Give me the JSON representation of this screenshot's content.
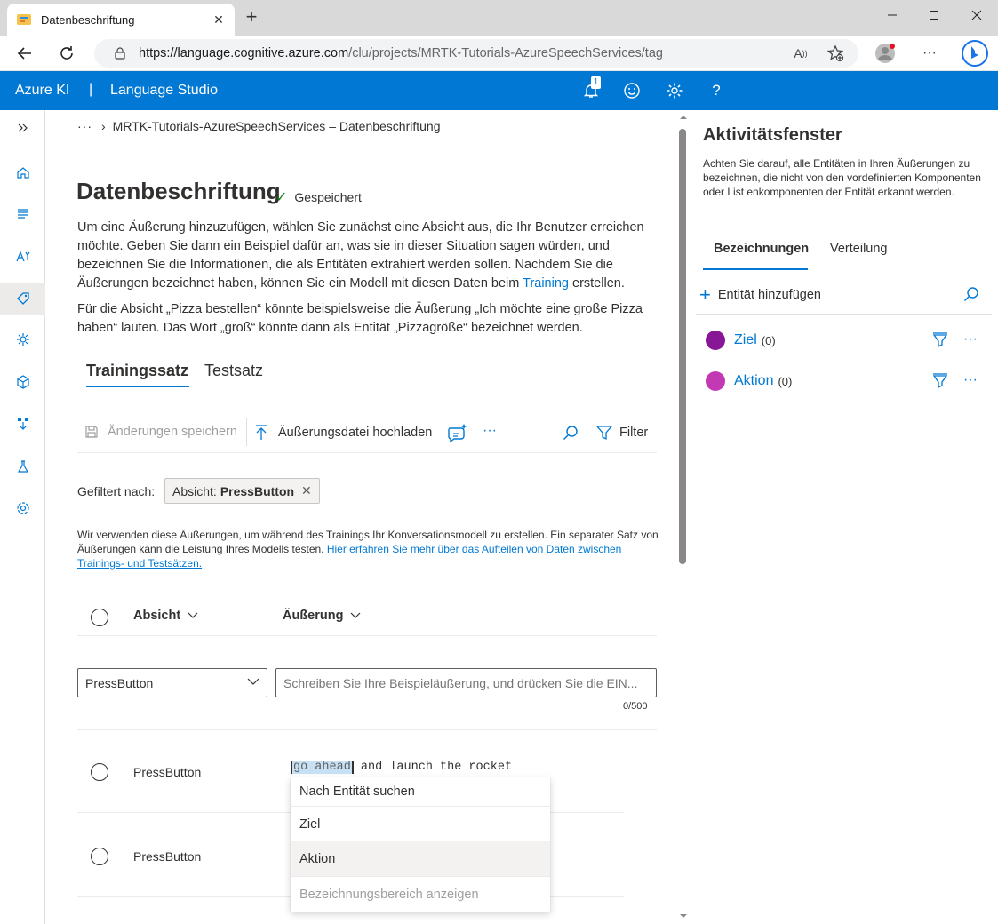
{
  "browser": {
    "tab_title": "Datenbeschriftung",
    "url_host": "https://language.cognitive.azure.com",
    "url_path": "/clu/projects/MRTK-Tutorials-AzureSpeechServices/tag"
  },
  "header": {
    "brand": "Azure KI",
    "separator": "|",
    "studio": "Language Studio",
    "notification_count": "1",
    "help": "?"
  },
  "breadcrumb": {
    "dots": "···",
    "chevron": "›",
    "text": "MRTK-Tutorials-AzureSpeechServices – Datenbeschriftung"
  },
  "page": {
    "title": "Datenbeschriftung",
    "saved_label": "Gespeichert",
    "intro_part1": "Um eine Äußerung hinzuzufügen, wählen Sie zunächst eine Absicht aus, die Ihr Benutzer erreichen möchte. Geben Sie dann ein Beispiel dafür an, was sie in dieser Situation sagen würden, und bezeichnen Sie die Informationen, die als Entitäten extrahiert werden sollen. Nachdem Sie die Äußerungen bezeichnet haben, können Sie ein Modell mit diesen Daten beim ",
    "intro_link": "Training",
    "intro_part2": " erstellen.",
    "example": "Für die Absicht „Pizza bestellen“ könnte beispielsweise die Äußerung „Ich möchte eine große Pizza haben“ lauten. Das Wort „groß“ könnte dann als Entität „Pizzagröße“ bezeichnet werden."
  },
  "pivots": {
    "training": "Trainingssatz",
    "test": "Testsatz"
  },
  "toolbar": {
    "save": "Änderungen speichern",
    "upload": "Äußerungsdatei hochladen",
    "more": "···",
    "filter": "Filter"
  },
  "filter": {
    "label": "Gefiltert nach:",
    "chip_prefix": "Absicht:",
    "chip_value": "PressButton",
    "chip_close": "✕"
  },
  "info": {
    "text": "Wir verwenden diese Äußerungen, um während des Trainings Ihr Konversationsmodell zu erstellen. Ein separater Satz von Äußerungen kann die Leistung Ihres Modells testen. ",
    "link": "Hier erfahren Sie mehr über das Aufteilen von Daten zwischen Trainings- und Testsätzen."
  },
  "table": {
    "col_intent": "Absicht",
    "col_utterance": "Äußerung"
  },
  "new_utterance": {
    "intent_selected": "PressButton",
    "placeholder": "Schreiben Sie Ihre Beispieläußerung, und drücken Sie die EIN...",
    "counter": "0/500"
  },
  "rows": [
    {
      "intent": "PressButton",
      "highlighted": "go ahead",
      "rest": " and launch the rocket"
    },
    {
      "intent": "PressButton"
    }
  ],
  "context_menu": {
    "search_placeholder": "Nach Entität suchen",
    "items": [
      "Ziel",
      "Aktion"
    ],
    "footer": "Bezeichnungsbereich anzeigen"
  },
  "panel": {
    "title": "Aktivitätsfenster",
    "description": "Achten Sie darauf, alle Entitäten in Ihren Äußerungen zu bezeichnen, die nicht von den vordefinierten Komponenten oder List enkomponenten der Entität erkannt werden.",
    "tab_labels": "Bezeichnungen",
    "tab_distribution": "Verteilung",
    "add_entity": "Entität hinzufügen",
    "entities": [
      {
        "name": "Ziel",
        "count": "(0)",
        "color": "#881798"
      },
      {
        "name": "Aktion",
        "count": "(0)",
        "color": "#c239b3"
      }
    ]
  },
  "colors": {
    "brand": "#0078d4",
    "saved_check": "#107c10"
  }
}
